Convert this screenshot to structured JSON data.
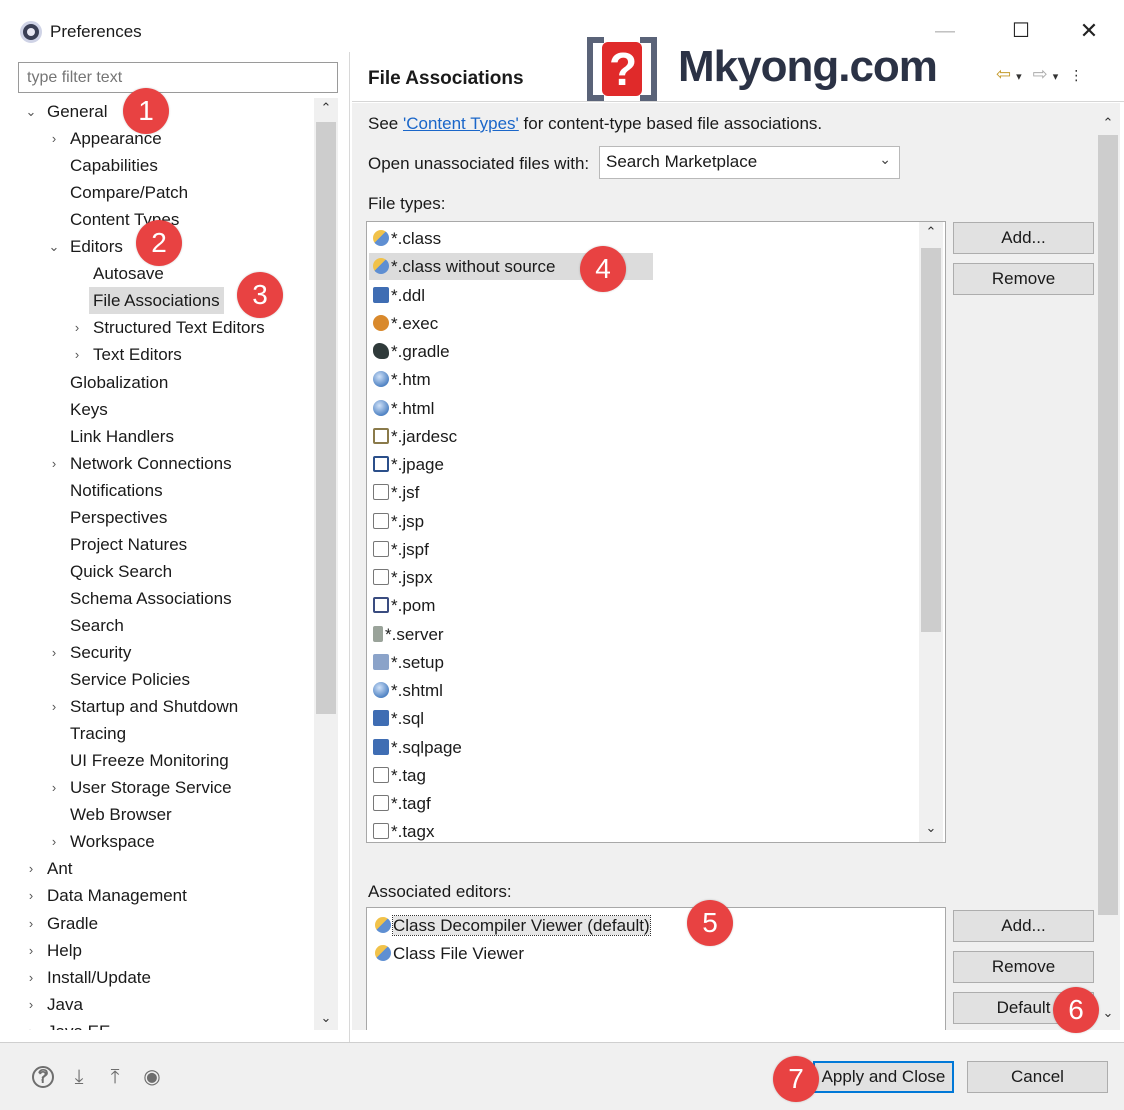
{
  "window": {
    "title": "Preferences",
    "minimize": "—",
    "maximize": "☐",
    "close": "✕"
  },
  "filter": {
    "placeholder": "type filter text"
  },
  "tree": [
    {
      "label": "General",
      "chevron": "⌄"
    },
    {
      "label": "Appearance",
      "chevron": "›"
    },
    {
      "label": "Capabilities",
      "chevron": ""
    },
    {
      "label": "Compare/Patch",
      "chevron": ""
    },
    {
      "label": "Content Types",
      "chevron": ""
    },
    {
      "label": "Editors",
      "chevron": "⌄"
    },
    {
      "label": "Autosave",
      "chevron": ""
    },
    {
      "label": "File Associations",
      "chevron": ""
    },
    {
      "label": "Structured Text Editors",
      "chevron": "›"
    },
    {
      "label": "Text Editors",
      "chevron": "›"
    },
    {
      "label": "Globalization",
      "chevron": ""
    },
    {
      "label": "Keys",
      "chevron": ""
    },
    {
      "label": "Link Handlers",
      "chevron": ""
    },
    {
      "label": "Network Connections",
      "chevron": "›"
    },
    {
      "label": "Notifications",
      "chevron": ""
    },
    {
      "label": "Perspectives",
      "chevron": ""
    },
    {
      "label": "Project Natures",
      "chevron": ""
    },
    {
      "label": "Quick Search",
      "chevron": ""
    },
    {
      "label": "Schema Associations",
      "chevron": ""
    },
    {
      "label": "Search",
      "chevron": ""
    },
    {
      "label": "Security",
      "chevron": "›"
    },
    {
      "label": "Service Policies",
      "chevron": ""
    },
    {
      "label": "Startup and Shutdown",
      "chevron": "›"
    },
    {
      "label": "Tracing",
      "chevron": ""
    },
    {
      "label": "UI Freeze Monitoring",
      "chevron": ""
    },
    {
      "label": "User Storage Service",
      "chevron": "›"
    },
    {
      "label": "Web Browser",
      "chevron": ""
    },
    {
      "label": "Workspace",
      "chevron": "›"
    },
    {
      "label": "Ant",
      "chevron": "›"
    },
    {
      "label": "Data Management",
      "chevron": "›"
    },
    {
      "label": "Gradle",
      "chevron": "›"
    },
    {
      "label": "Help",
      "chevron": "›"
    },
    {
      "label": "Install/Update",
      "chevron": "›"
    },
    {
      "label": "Java",
      "chevron": "›"
    },
    {
      "label": "Java EE",
      "chevron": "›"
    }
  ],
  "page": {
    "title": "File Associations",
    "logo_text": "Mkyong.com",
    "logo_mark": "?",
    "nav_back": "⇦",
    "nav_forward": "⇨",
    "nav_dropdown": "▾",
    "nav_menu": "⋮",
    "see_prefix": "See ",
    "see_link": "'Content Types'",
    "see_suffix": " for content-type based file associations.",
    "open_with_label": "Open unassociated files with:",
    "open_with_value": "Search Marketplace",
    "file_types_label": "File types:",
    "associated_editors_label": "Associated editors:"
  },
  "file_types": [
    {
      "label": "*.class",
      "icon": "class-file-icon"
    },
    {
      "label": "*.class without source",
      "icon": "class-file-icon"
    },
    {
      "label": "*.ddl",
      "icon": "database-file-icon"
    },
    {
      "label": "*.exec",
      "icon": "gear-file-icon"
    },
    {
      "label": "*.gradle",
      "icon": "gradle-elephant-icon"
    },
    {
      "label": "*.htm",
      "icon": "globe-icon"
    },
    {
      "label": "*.html",
      "icon": "globe-icon"
    },
    {
      "label": "*.jardesc",
      "icon": "jar-file-icon"
    },
    {
      "label": "*.jpage",
      "icon": "java-page-icon"
    },
    {
      "label": "*.jsf",
      "icon": "text-file-icon"
    },
    {
      "label": "*.jsp",
      "icon": "text-file-icon"
    },
    {
      "label": "*.jspf",
      "icon": "text-file-icon"
    },
    {
      "label": "*.jspx",
      "icon": "text-file-icon"
    },
    {
      "label": "*.pom",
      "icon": "maven-file-icon"
    },
    {
      "label": "*.server",
      "icon": "server-file-icon"
    },
    {
      "label": "*.setup",
      "icon": "setup-file-icon"
    },
    {
      "label": "*.shtml",
      "icon": "globe-icon"
    },
    {
      "label": "*.sql",
      "icon": "database-file-icon"
    },
    {
      "label": "*.sqlpage",
      "icon": "database-file-icon"
    },
    {
      "label": "*.tag",
      "icon": "text-file-icon"
    },
    {
      "label": "*.tagf",
      "icon": "text-file-icon"
    },
    {
      "label": "*.tagx",
      "icon": "text-file-icon"
    }
  ],
  "editors": [
    {
      "label": "Class Decompiler Viewer (default)",
      "icon": "class-file-icon"
    },
    {
      "label": "Class File Viewer",
      "icon": "class-viewer-icon"
    }
  ],
  "buttons": {
    "add_types": "Add...",
    "remove_types": "Remove",
    "add_editors": "Add...",
    "remove_editors": "Remove",
    "default": "Default",
    "apply_close": "Apply and Close",
    "cancel": "Cancel"
  },
  "badges": [
    "1",
    "2",
    "3",
    "4",
    "5",
    "6",
    "7"
  ],
  "colors": {
    "badge": "#e84242",
    "link": "#1a66c9",
    "selection": "#dcdcdc"
  }
}
